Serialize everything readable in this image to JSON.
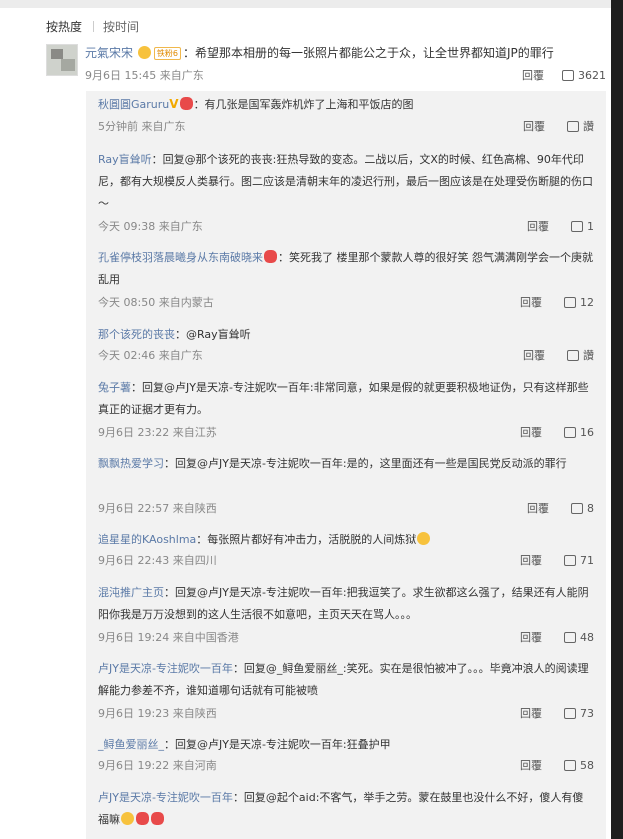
{
  "sort": {
    "hot": "按热度",
    "time": "按时间"
  },
  "top_comment": {
    "user": "元氣宋宋",
    "badge": "铁粉6",
    "text": "：希望那本相册的每一张照片都能公之于众，让全世界都知道JP的罪行",
    "time": "9月6日 15:45 来自广东",
    "reply_label": "回覆",
    "likes": "3621"
  },
  "replies": [
    {
      "user": "秋圓圓Garuru",
      "text": "：有几张是国军轰炸机炸了上海和平饭店的图",
      "time": "5分钟前 来自广东",
      "reply_label": "回覆",
      "likes": "讚"
    },
    {
      "user": "Ray盲耸听",
      "text": "：回复@那个该死的丧丧:狂热导致的变态。二战以后，文X的时候、红色高棉、90年代印尼，都有大规模反人类暴行。图二应该是清朝末年的凌迟行刑，最后一图应该是在处理受伤断腿的伤口～",
      "time": "今天 09:38 来自广东",
      "reply_label": "回覆",
      "likes": "1"
    },
    {
      "user": "孔雀停枝羽落晨曦身从东南破晓来",
      "text": "：笑死我了 楼里那个蒙款人尊的很好笑 怨气满满刚学会一个庚就乱用",
      "time": "今天 08:50 来自内蒙古",
      "reply_label": "回覆",
      "likes": "12"
    },
    {
      "user": "那个该死的丧丧",
      "text": "：@Ray盲耸听",
      "time": "今天 02:46 来自广东",
      "reply_label": "回覆",
      "likes": "讚"
    },
    {
      "user": "兔子薯",
      "text": "：回复@卢JY是天凉-专注妮吹一百年:非常同意，如果是假的就更要积极地证伪，只有这样那些真正的证据才更有力。",
      "time": "9月6日 23:22 来自江苏",
      "reply_label": "回覆",
      "likes": "16"
    },
    {
      "user": "飘飘热爱学习",
      "text": "：回复@卢JY是天凉-专注妮吹一百年:是的，这里面还有一些是国民党反动派的罪行",
      "time": "9月6日 22:57 来自陕西",
      "reply_label": "回覆",
      "likes": "8"
    },
    {
      "user": "追星星的KAoshlma",
      "text": "：每张照片都好有冲击力，活脱脱的人间炼狱",
      "time": "9月6日 22:43 来自四川",
      "reply_label": "回覆",
      "likes": "71"
    },
    {
      "user": "混沌推广主页",
      "text": "：回复@卢JY是天凉-专注妮吹一百年:把我逗笑了。求生欲都这么强了，结果还有人能阴阳你我是万万没想到的这人生活很不如意吧，主页天天在骂人。。。",
      "time": "9月6日 19:24 来自中国香港",
      "reply_label": "回覆",
      "likes": "48"
    },
    {
      "user": "卢JY是天凉-专注妮吹一百年",
      "text": "：回复@_鲟鱼爱丽丝_:笑死。实在是很怕被冲了。。。毕竟冲浪人的阅读理解能力参差不齐，谁知道哪句话就有可能被喷",
      "time": "9月6日 19:23 来自陕西",
      "reply_label": "回覆",
      "likes": "73"
    },
    {
      "user": "_鲟鱼爱丽丝_",
      "text": "：回复@卢JY是天凉-专注妮吹一百年:狂叠护甲",
      "time": "9月6日 19:22 来自河南",
      "reply_label": "回覆",
      "likes": "58"
    },
    {
      "user": "卢JY是天凉-专注妮吹一百年",
      "text": "：回复@起个aid:不客气，举手之劳。蒙在鼓里也没什么不好，傻人有傻福嘛",
      "time": "",
      "reply_label": "",
      "likes": ""
    }
  ]
}
